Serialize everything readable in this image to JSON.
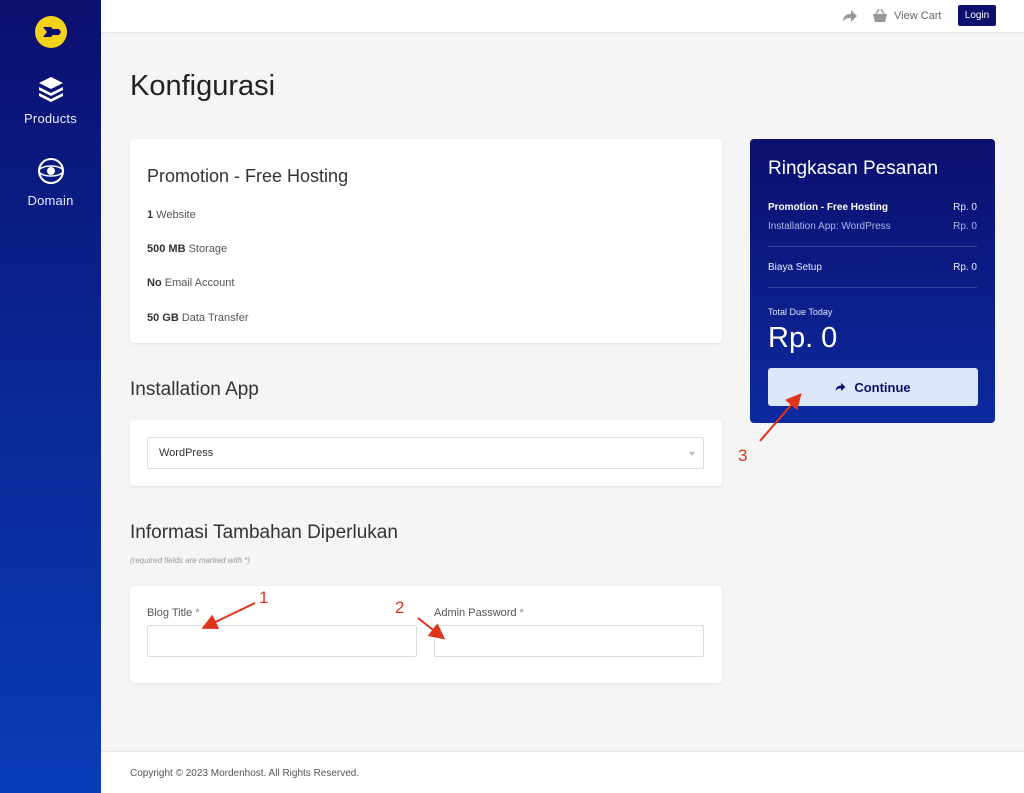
{
  "sidebar": {
    "logo_icon": "brand-logo-icon",
    "items": [
      {
        "label": "Products",
        "icon": "cube-icon"
      },
      {
        "label": "Domain",
        "icon": "globe-icon"
      }
    ]
  },
  "topbar": {
    "share_icon": "share-arrow-icon",
    "cart_icon": "basket-icon",
    "view_cart": "View Cart",
    "login": "Login"
  },
  "page": {
    "title": "Konfigurasi"
  },
  "product": {
    "name": "Promotion - Free Hosting",
    "features": [
      {
        "bold": "1",
        "text": " Website"
      },
      {
        "bold": "500 MB",
        "text": " Storage"
      },
      {
        "bold": "No",
        "text": " Email Account"
      },
      {
        "bold": "50 GB",
        "text": " Data Transfer"
      }
    ]
  },
  "installation": {
    "title": "Installation App",
    "selected": "WordPress"
  },
  "additional_info": {
    "title": "Informasi Tambahan Diperlukan",
    "required_note": "(required fields are marked with *)",
    "fields": [
      {
        "label": "Blog Title",
        "required": "*",
        "value": ""
      },
      {
        "label": "Admin Password",
        "required": "*",
        "value": ""
      }
    ]
  },
  "summary": {
    "title": "Ringkasan Pesanan",
    "lines": [
      {
        "label": "Promotion - Free Hosting",
        "price": "Rp. 0"
      },
      {
        "label": "Installation App: WordPress",
        "price": "Rp. 0"
      },
      {
        "label": "Biaya Setup",
        "price": "Rp. 0"
      }
    ],
    "total_label": "Total Due Today",
    "total_value": "Rp. 0",
    "continue": "Continue"
  },
  "annotations": [
    "1",
    "2",
    "3"
  ],
  "footer": {
    "copyright": "Copyright © 2023 Mordenhost. All Rights Reserved."
  },
  "colors": {
    "sidebar_top": "#0b0f6e",
    "sidebar_bottom": "#0a3cb8",
    "logo": "#f5d21a",
    "accent": "#0c0f6d",
    "continue_bg": "#dce7fa",
    "annotation": "#e0341c"
  }
}
